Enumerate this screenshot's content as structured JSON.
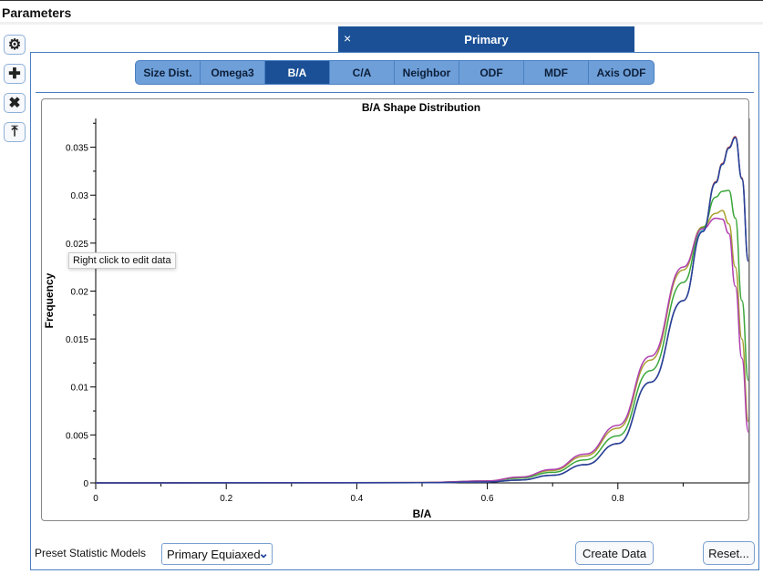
{
  "header": {
    "title": "Parameters"
  },
  "toolbar": [
    {
      "icon": "gear-icon",
      "glyph": "⚙"
    },
    {
      "icon": "plus-icon",
      "glyph": "✚"
    },
    {
      "icon": "close-icon",
      "glyph": "✖"
    },
    {
      "icon": "upload-icon",
      "glyph": "⤒"
    }
  ],
  "phase_tab": {
    "close": "×",
    "label": "Primary"
  },
  "tabs": [
    {
      "label": "Size Dist."
    },
    {
      "label": "Omega3"
    },
    {
      "label": "B/A",
      "active": true
    },
    {
      "label": "C/A"
    },
    {
      "label": "Neighbor"
    },
    {
      "label": "ODF"
    },
    {
      "label": "MDF"
    },
    {
      "label": "Axis ODF"
    }
  ],
  "tooltip": "Right click to edit data",
  "chart_data": {
    "type": "line",
    "title": "B/A Shape Distribution",
    "xlabel": "B/A",
    "ylabel": "Frequency",
    "xlim": [
      0,
      1
    ],
    "ylim": [
      0,
      0.038
    ],
    "xticks": [
      0,
      0.2,
      0.4,
      0.6,
      0.8
    ],
    "yticks": [
      0,
      0.005,
      0.01,
      0.015,
      0.02,
      0.025,
      0.03,
      0.035
    ],
    "grid": false,
    "x": [
      0,
      0.5,
      0.6,
      0.65,
      0.7,
      0.75,
      0.8,
      0.85,
      0.9,
      0.93,
      0.95,
      0.96,
      0.97,
      0.98,
      0.99,
      1.0
    ],
    "series": [
      {
        "color": "#c0392b",
        "values": [
          0,
          2e-05,
          0.0001,
          0.0003,
          0.0008,
          0.0019,
          0.0041,
          0.0105,
          0.019,
          0.0263,
          0.0314,
          0.0333,
          0.035,
          0.0361,
          0.0318,
          0.0232
        ]
      },
      {
        "color": "#2ab0c8",
        "values": [
          0,
          2e-05,
          0.0001,
          0.0003,
          0.0008,
          0.0019,
          0.0041,
          0.0105,
          0.019,
          0.0263,
          0.0313,
          0.0332,
          0.0349,
          0.036,
          0.0317,
          0.0231
        ]
      },
      {
        "color": "#a9a030",
        "values": [
          0,
          3e-05,
          0.0002,
          0.0006,
          0.0013,
          0.0028,
          0.0057,
          0.0128,
          0.0222,
          0.0267,
          0.0281,
          0.0284,
          0.027,
          0.0225,
          0.015,
          0.0064
        ]
      },
      {
        "color": "#3aa63a",
        "values": [
          0,
          3e-05,
          0.0002,
          0.0005,
          0.0011,
          0.0024,
          0.0049,
          0.0117,
          0.0209,
          0.0266,
          0.0298,
          0.0304,
          0.0305,
          0.0276,
          0.019,
          0.0107
        ]
      },
      {
        "color": "#b040b0",
        "values": [
          0,
          3e-05,
          0.0002,
          0.0006,
          0.0014,
          0.003,
          0.006,
          0.0132,
          0.0225,
          0.0265,
          0.0276,
          0.0275,
          0.026,
          0.0205,
          0.013,
          0.0053
        ]
      },
      {
        "color": "#2d3e9a",
        "values": [
          0,
          2e-05,
          0.0001,
          0.0003,
          0.0008,
          0.0019,
          0.0041,
          0.0105,
          0.019,
          0.0262,
          0.0313,
          0.0332,
          0.0349,
          0.036,
          0.0317,
          0.0231
        ]
      }
    ]
  },
  "footer": {
    "preset_label": "Preset Statistic Models",
    "preset_value": "Primary Equiaxed",
    "create": "Create Data",
    "reset": "Reset..."
  }
}
